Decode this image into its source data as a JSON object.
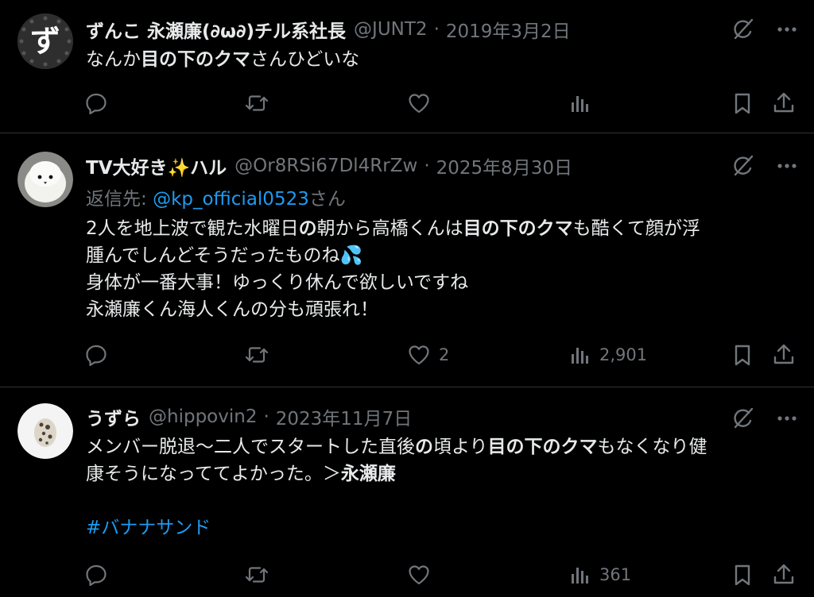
{
  "posts": [
    {
      "avatar_char": "ず",
      "name": "ずんこ 永瀬廉(∂ω∂)チル系社長",
      "handle": "@JUNT2",
      "date": "2019年3月2日",
      "body": [
        [
          {
            "t": "なんか"
          },
          {
            "t": "目の下のクマ",
            "b": true
          },
          {
            "t": "さんひどいな"
          }
        ]
      ],
      "counts": {
        "replies": "",
        "reposts": "",
        "likes": "",
        "views": ""
      }
    },
    {
      "avatar_char": "",
      "name": "TV大好き✨ハル",
      "handle": "@Or8RSi67Dl4RrZw",
      "date": "2025年8月30日",
      "reply_prefix": "返信先: ",
      "reply_mention": "@kp_official0523",
      "reply_suffix": "さん",
      "body": [
        [
          {
            "t": "2人を地上波で観た水曜日"
          },
          {
            "t": "の",
            "b": true
          },
          {
            "t": "朝から高橋くんは"
          },
          {
            "t": "目の下のクマ",
            "b": true
          },
          {
            "t": "も酷くて顔が浮"
          }
        ],
        [
          {
            "t": "腫んでしんどそうだったものね💦"
          }
        ],
        [
          {
            "t": "身体が一番大事！ゆっくり休んで欲しいですね"
          }
        ],
        [
          {
            "t": "永瀬廉くん海人くんの分も頑張れ！"
          }
        ]
      ],
      "counts": {
        "replies": "",
        "reposts": "",
        "likes": "2",
        "views": "2,901"
      }
    },
    {
      "avatar_char": "",
      "name": "うずら",
      "handle": "@hippovin2",
      "date": "2023年11月7日",
      "body": [
        [
          {
            "t": "メンバー脱退〜二人でスタートした直後"
          },
          {
            "t": "の",
            "b": true
          },
          {
            "t": "頃より"
          },
          {
            "t": "目の下のクマ",
            "b": true
          },
          {
            "t": "もなくなり健"
          }
        ],
        [
          {
            "t": "康そうになっててよかった。＞"
          },
          {
            "t": "永瀬廉",
            "b": true
          }
        ],
        [],
        [
          {
            "t": "#バナナサンド",
            "h": true
          }
        ]
      ],
      "counts": {
        "replies": "",
        "reposts": "",
        "likes": "",
        "views": "361"
      }
    }
  ],
  "icons": [
    "grok-icon",
    "more-icon",
    "reply-icon",
    "repost-icon",
    "like-icon",
    "views-icon",
    "bookmark-icon",
    "share-icon"
  ],
  "colors": {
    "background": "#000000",
    "text": "#e7e9ea",
    "muted": "#71767b",
    "link": "#1d9bf0",
    "divider": "#2f3336"
  }
}
